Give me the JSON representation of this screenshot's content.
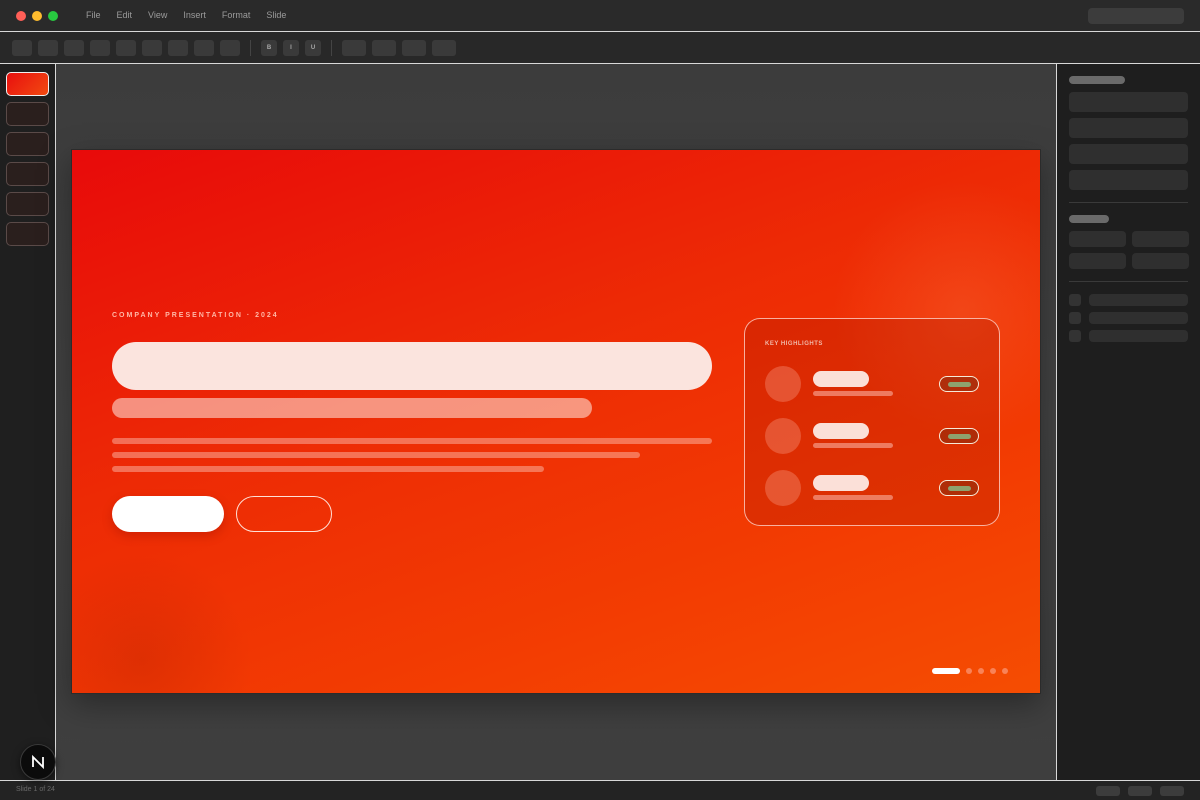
{
  "window": {
    "menu": [
      "File",
      "Edit",
      "View",
      "Insert",
      "Format",
      "Slide"
    ]
  },
  "toolbar": {
    "format_buttons": [
      "B",
      "I",
      "U"
    ]
  },
  "slides_panel": {
    "count_visible": 6,
    "active_index": 0
  },
  "slide": {
    "eyebrow": "COMPANY PRESENTATION · 2024",
    "highlights": {
      "title": "KEY HIGHLIGHTS",
      "rows": 3
    },
    "pager": {
      "total": 5,
      "active": 0
    },
    "colors": {
      "gradient_start": "#e80a0a",
      "gradient_end": "#f54d02",
      "badge_fill": "#8ea26e"
    }
  },
  "status": {
    "slide_counter": "Slide 1 of 24"
  },
  "icons": {
    "logo": "n-logo-icon"
  }
}
